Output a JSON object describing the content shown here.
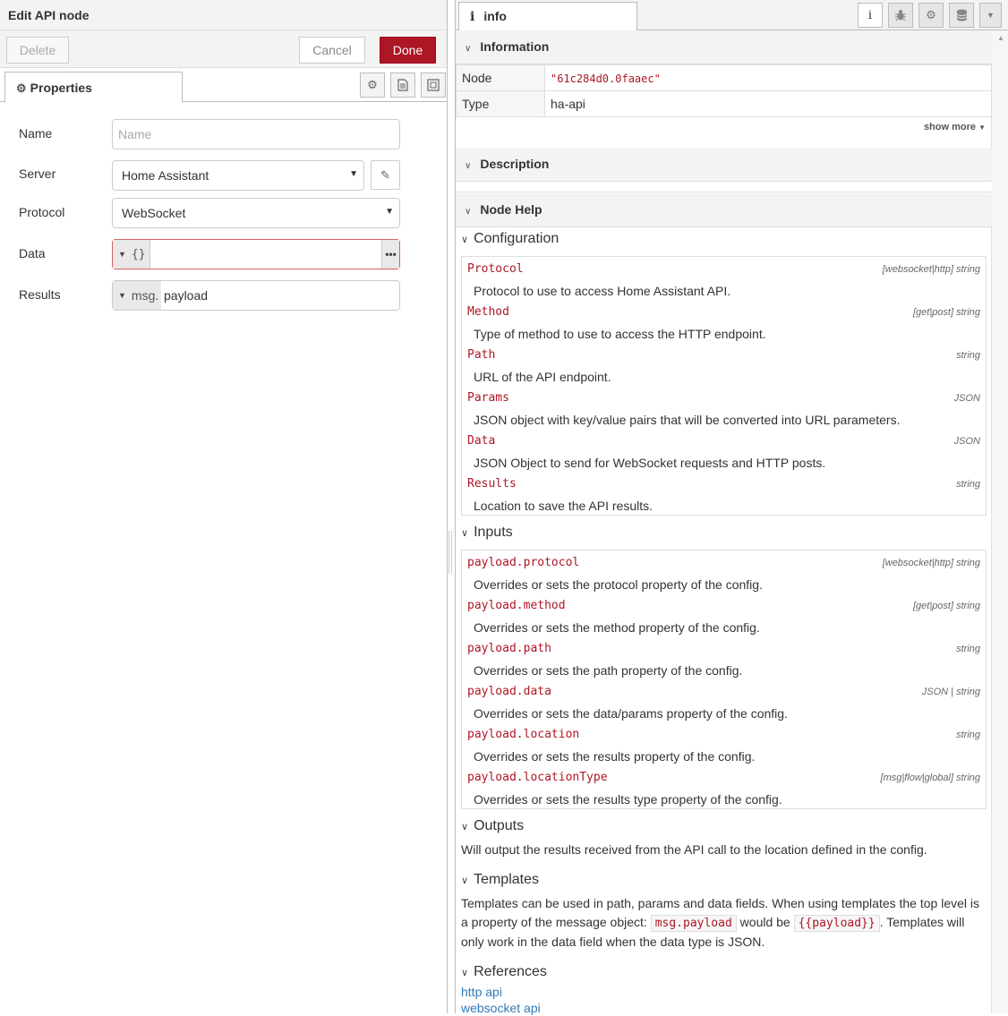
{
  "tray": {
    "title": "Edit API node",
    "delete_label": "Delete",
    "cancel_label": "Cancel",
    "done_label": "Done",
    "tab_label": "Properties",
    "fields": {
      "name": {
        "label": "Name",
        "placeholder": "Name",
        "value": ""
      },
      "server": {
        "label": "Server",
        "value": "Home Assistant"
      },
      "protocol": {
        "label": "Protocol",
        "value": "WebSocket"
      },
      "data": {
        "label": "Data",
        "type_label": "{}",
        "value": ""
      },
      "results": {
        "label": "Results",
        "type_label": "msg.",
        "value": "payload"
      }
    },
    "colors": {
      "done": "#ad1625",
      "data_border": "#d6615f"
    }
  },
  "sidebar": {
    "tab_label": "info",
    "information": {
      "heading": "Information",
      "node_key": "Node",
      "node_value": "\"61c284d0.0faaec\"",
      "type_key": "Type",
      "type_value": "ha-api",
      "show_more": "show more"
    },
    "description_heading": "Description",
    "node_help_heading": "Node Help",
    "help": {
      "configuration": {
        "title": "Configuration",
        "props": [
          {
            "name": "Protocol",
            "type": "[websocket|http] string",
            "desc": "Protocol to use to access Home Assistant API."
          },
          {
            "name": "Method",
            "type": "[get|post] string",
            "desc": "Type of method to use to access the HTTP endpoint."
          },
          {
            "name": "Path",
            "type": "string",
            "desc": "URL of the API endpoint."
          },
          {
            "name": "Params",
            "type": "JSON",
            "desc": "JSON object with key/value pairs that will be converted into URL parameters."
          },
          {
            "name": "Data",
            "type": "JSON",
            "desc": "JSON Object to send for WebSocket requests and HTTP posts."
          },
          {
            "name": "Results",
            "type": "string",
            "desc": "Location to save the API results."
          }
        ]
      },
      "inputs": {
        "title": "Inputs",
        "props": [
          {
            "name": "payload.protocol",
            "type": "[websocket|http] string",
            "desc": "Overrides or sets the protocol property of the config."
          },
          {
            "name": "payload.method",
            "type": "[get|post] string",
            "desc": "Overrides or sets the method property of the config."
          },
          {
            "name": "payload.path",
            "type": "string",
            "desc": "Overrides or sets the path property of the config."
          },
          {
            "name": "payload.data",
            "type": "JSON | string",
            "desc": "Overrides or sets the data/params property of the config."
          },
          {
            "name": "payload.location",
            "type": "string",
            "desc": "Overrides or sets the results property of the config."
          },
          {
            "name": "payload.locationType",
            "type": "[msg|flow|global] string",
            "desc": "Overrides or sets the results type property of the config."
          }
        ]
      },
      "outputs": {
        "title": "Outputs",
        "text": "Will output the results received from the API call to the location defined in the config."
      },
      "templates": {
        "title": "Templates",
        "text_1": "Templates can be used in path, params and data fields. When using templates the top level is a property of the message object:",
        "code_1": "msg.payload",
        "text_2": "would be",
        "code_2": "{{payload}}",
        "text_3": ". Templates will only work in the data field when the data type is JSON."
      },
      "references": {
        "title": "References",
        "links": [
          "http api",
          "websocket api"
        ]
      }
    }
  }
}
